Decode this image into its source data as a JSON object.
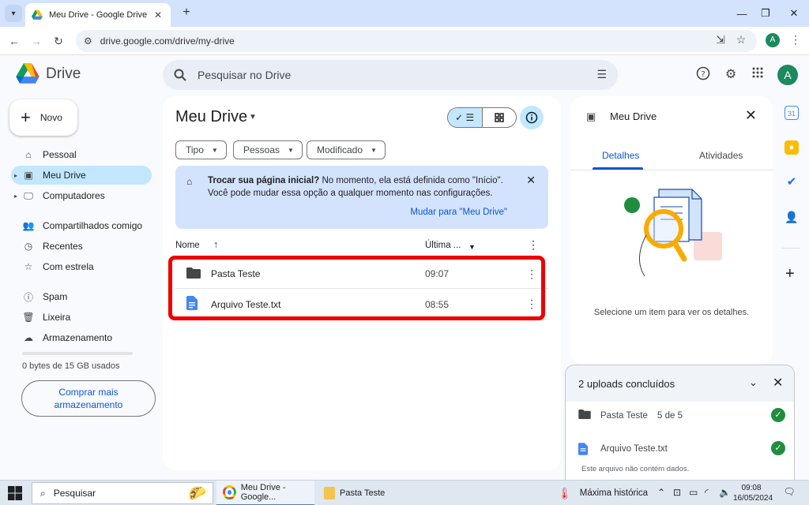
{
  "browser": {
    "tab_title": "Meu Drive - Google Drive",
    "url": "drive.google.com/drive/my-drive",
    "profile_initial": "A"
  },
  "drive": {
    "app_name": "Drive",
    "search_placeholder": "Pesquisar no Drive",
    "avatar_initial": "A"
  },
  "sidebar": {
    "new_label": "Novo",
    "items": [
      {
        "label": "Pessoal",
        "icon": "home-icon"
      },
      {
        "label": "Meu Drive",
        "icon": "my-drive-icon"
      },
      {
        "label": "Computadores",
        "icon": "computers-icon"
      },
      {
        "label": "Compartilhados comigo",
        "icon": "shared-icon"
      },
      {
        "label": "Recentes",
        "icon": "clock-icon"
      },
      {
        "label": "Com estrela",
        "icon": "star-icon"
      },
      {
        "label": "Spam",
        "icon": "spam-icon"
      },
      {
        "label": "Lixeira",
        "icon": "trash-icon"
      },
      {
        "label": "Armazenamento",
        "icon": "cloud-icon"
      }
    ],
    "storage_text": "0 bytes de 15 GB usados",
    "buy_storage_label": "Comprar mais armazenamento"
  },
  "main": {
    "title": "Meu Drive",
    "filters": [
      "Tipo",
      "Pessoas",
      "Modificado"
    ],
    "banner": {
      "bold": "Trocar sua página inicial?",
      "text": " No momento, ela está definida como \"Início\". Você pode mudar essa opção a qualquer momento nas configurações.",
      "link": "Mudar para \"Meu Drive\""
    },
    "columns": {
      "name": "Nome",
      "modified": "Última ..."
    },
    "files": [
      {
        "name": "Pasta Teste",
        "time": "09:07",
        "type": "folder"
      },
      {
        "name": "Arquivo Teste.txt",
        "time": "08:55",
        "type": "doc"
      }
    ]
  },
  "details": {
    "title": "Meu Drive",
    "tabs": [
      "Detalhes",
      "Atividades"
    ],
    "hint": "Selecione um item para ver os detalhes."
  },
  "uploads": {
    "title": "2 uploads concluídos",
    "items": [
      {
        "name": "Pasta Teste",
        "count": "5 de 5"
      },
      {
        "name": "Arquivo Teste.txt",
        "count": ""
      }
    ],
    "note": "Este arquivo não contém dados."
  },
  "taskbar": {
    "search_placeholder": "Pesquisar",
    "apps": [
      "Meu Drive - Google...",
      "Pasta Teste"
    ],
    "weather": "Máxima histórica",
    "time": "09:08",
    "date": "16/05/2024"
  },
  "colors": {
    "accent": "#0b57d0",
    "active_nav": "#c2e7ff",
    "highlight": "#ee0000",
    "success": "#1e8e3e"
  }
}
